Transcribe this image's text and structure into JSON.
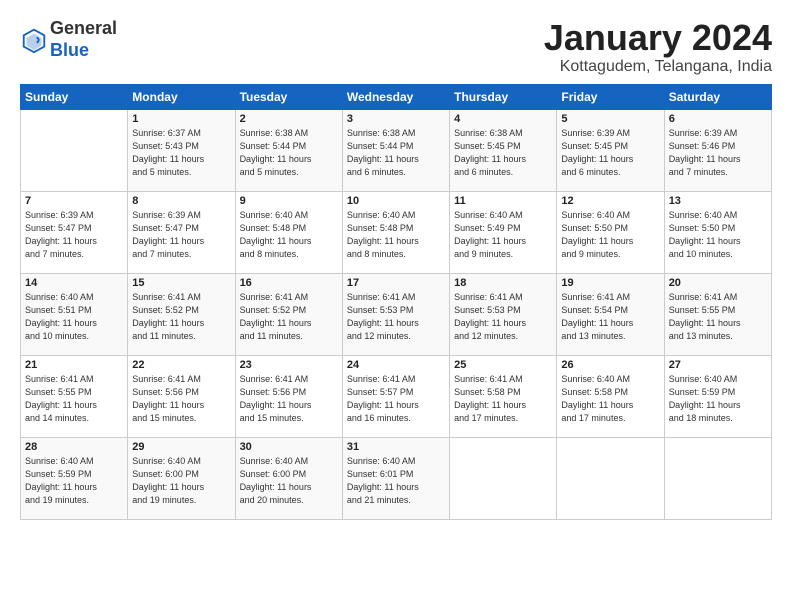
{
  "header": {
    "logo_line1": "General",
    "logo_line2": "Blue",
    "month": "January 2024",
    "location": "Kottagudem, Telangana, India"
  },
  "days_of_week": [
    "Sunday",
    "Monday",
    "Tuesday",
    "Wednesday",
    "Thursday",
    "Friday",
    "Saturday"
  ],
  "weeks": [
    [
      {
        "num": "",
        "info": ""
      },
      {
        "num": "1",
        "info": "Sunrise: 6:37 AM\nSunset: 5:43 PM\nDaylight: 11 hours\nand 5 minutes."
      },
      {
        "num": "2",
        "info": "Sunrise: 6:38 AM\nSunset: 5:44 PM\nDaylight: 11 hours\nand 5 minutes."
      },
      {
        "num": "3",
        "info": "Sunrise: 6:38 AM\nSunset: 5:44 PM\nDaylight: 11 hours\nand 6 minutes."
      },
      {
        "num": "4",
        "info": "Sunrise: 6:38 AM\nSunset: 5:45 PM\nDaylight: 11 hours\nand 6 minutes."
      },
      {
        "num": "5",
        "info": "Sunrise: 6:39 AM\nSunset: 5:45 PM\nDaylight: 11 hours\nand 6 minutes."
      },
      {
        "num": "6",
        "info": "Sunrise: 6:39 AM\nSunset: 5:46 PM\nDaylight: 11 hours\nand 7 minutes."
      }
    ],
    [
      {
        "num": "7",
        "info": "Sunrise: 6:39 AM\nSunset: 5:47 PM\nDaylight: 11 hours\nand 7 minutes."
      },
      {
        "num": "8",
        "info": "Sunrise: 6:39 AM\nSunset: 5:47 PM\nDaylight: 11 hours\nand 7 minutes."
      },
      {
        "num": "9",
        "info": "Sunrise: 6:40 AM\nSunset: 5:48 PM\nDaylight: 11 hours\nand 8 minutes."
      },
      {
        "num": "10",
        "info": "Sunrise: 6:40 AM\nSunset: 5:48 PM\nDaylight: 11 hours\nand 8 minutes."
      },
      {
        "num": "11",
        "info": "Sunrise: 6:40 AM\nSunset: 5:49 PM\nDaylight: 11 hours\nand 9 minutes."
      },
      {
        "num": "12",
        "info": "Sunrise: 6:40 AM\nSunset: 5:50 PM\nDaylight: 11 hours\nand 9 minutes."
      },
      {
        "num": "13",
        "info": "Sunrise: 6:40 AM\nSunset: 5:50 PM\nDaylight: 11 hours\nand 10 minutes."
      }
    ],
    [
      {
        "num": "14",
        "info": "Sunrise: 6:40 AM\nSunset: 5:51 PM\nDaylight: 11 hours\nand 10 minutes."
      },
      {
        "num": "15",
        "info": "Sunrise: 6:41 AM\nSunset: 5:52 PM\nDaylight: 11 hours\nand 11 minutes."
      },
      {
        "num": "16",
        "info": "Sunrise: 6:41 AM\nSunset: 5:52 PM\nDaylight: 11 hours\nand 11 minutes."
      },
      {
        "num": "17",
        "info": "Sunrise: 6:41 AM\nSunset: 5:53 PM\nDaylight: 11 hours\nand 12 minutes."
      },
      {
        "num": "18",
        "info": "Sunrise: 6:41 AM\nSunset: 5:53 PM\nDaylight: 11 hours\nand 12 minutes."
      },
      {
        "num": "19",
        "info": "Sunrise: 6:41 AM\nSunset: 5:54 PM\nDaylight: 11 hours\nand 13 minutes."
      },
      {
        "num": "20",
        "info": "Sunrise: 6:41 AM\nSunset: 5:55 PM\nDaylight: 11 hours\nand 13 minutes."
      }
    ],
    [
      {
        "num": "21",
        "info": "Sunrise: 6:41 AM\nSunset: 5:55 PM\nDaylight: 11 hours\nand 14 minutes."
      },
      {
        "num": "22",
        "info": "Sunrise: 6:41 AM\nSunset: 5:56 PM\nDaylight: 11 hours\nand 15 minutes."
      },
      {
        "num": "23",
        "info": "Sunrise: 6:41 AM\nSunset: 5:56 PM\nDaylight: 11 hours\nand 15 minutes."
      },
      {
        "num": "24",
        "info": "Sunrise: 6:41 AM\nSunset: 5:57 PM\nDaylight: 11 hours\nand 16 minutes."
      },
      {
        "num": "25",
        "info": "Sunrise: 6:41 AM\nSunset: 5:58 PM\nDaylight: 11 hours\nand 17 minutes."
      },
      {
        "num": "26",
        "info": "Sunrise: 6:40 AM\nSunset: 5:58 PM\nDaylight: 11 hours\nand 17 minutes."
      },
      {
        "num": "27",
        "info": "Sunrise: 6:40 AM\nSunset: 5:59 PM\nDaylight: 11 hours\nand 18 minutes."
      }
    ],
    [
      {
        "num": "28",
        "info": "Sunrise: 6:40 AM\nSunset: 5:59 PM\nDaylight: 11 hours\nand 19 minutes."
      },
      {
        "num": "29",
        "info": "Sunrise: 6:40 AM\nSunset: 6:00 PM\nDaylight: 11 hours\nand 19 minutes."
      },
      {
        "num": "30",
        "info": "Sunrise: 6:40 AM\nSunset: 6:00 PM\nDaylight: 11 hours\nand 20 minutes."
      },
      {
        "num": "31",
        "info": "Sunrise: 6:40 AM\nSunset: 6:01 PM\nDaylight: 11 hours\nand 21 minutes."
      },
      {
        "num": "",
        "info": ""
      },
      {
        "num": "",
        "info": ""
      },
      {
        "num": "",
        "info": ""
      }
    ]
  ]
}
